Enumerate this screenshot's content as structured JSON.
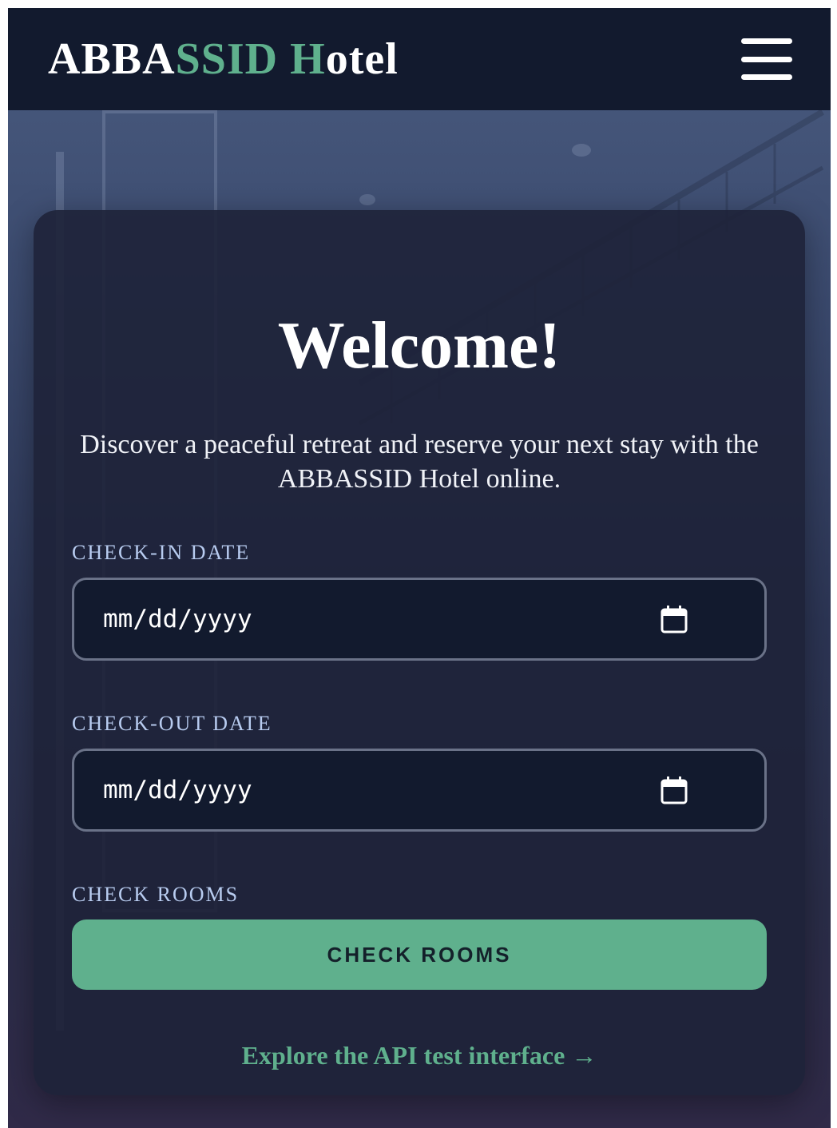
{
  "header": {
    "brand_part1": "ABBA",
    "brand_part2": "SSID H",
    "brand_part3": "otel",
    "menu_icon": "hamburger-menu-icon"
  },
  "hero": {
    "title": "Welcome!",
    "subtitle": "Discover a peaceful retreat and reserve your next stay with the ABBASSID Hotel online."
  },
  "form": {
    "checkin_label": "CHECK-IN DATE",
    "checkin_placeholder": "mm/dd/yyyy",
    "checkout_label": "CHECK-OUT DATE",
    "checkout_placeholder": "mm/dd/yyyy",
    "check_rooms_label": "CHECK ROOMS",
    "check_rooms_button": "CHECK ROOMS",
    "calendar_icon": "calendar-icon"
  },
  "footer_link": {
    "text": "Explore the API test interface →"
  },
  "colors": {
    "accent": "#5fb08d",
    "navbar": "#121a2e",
    "label": "#b8ccf0"
  }
}
